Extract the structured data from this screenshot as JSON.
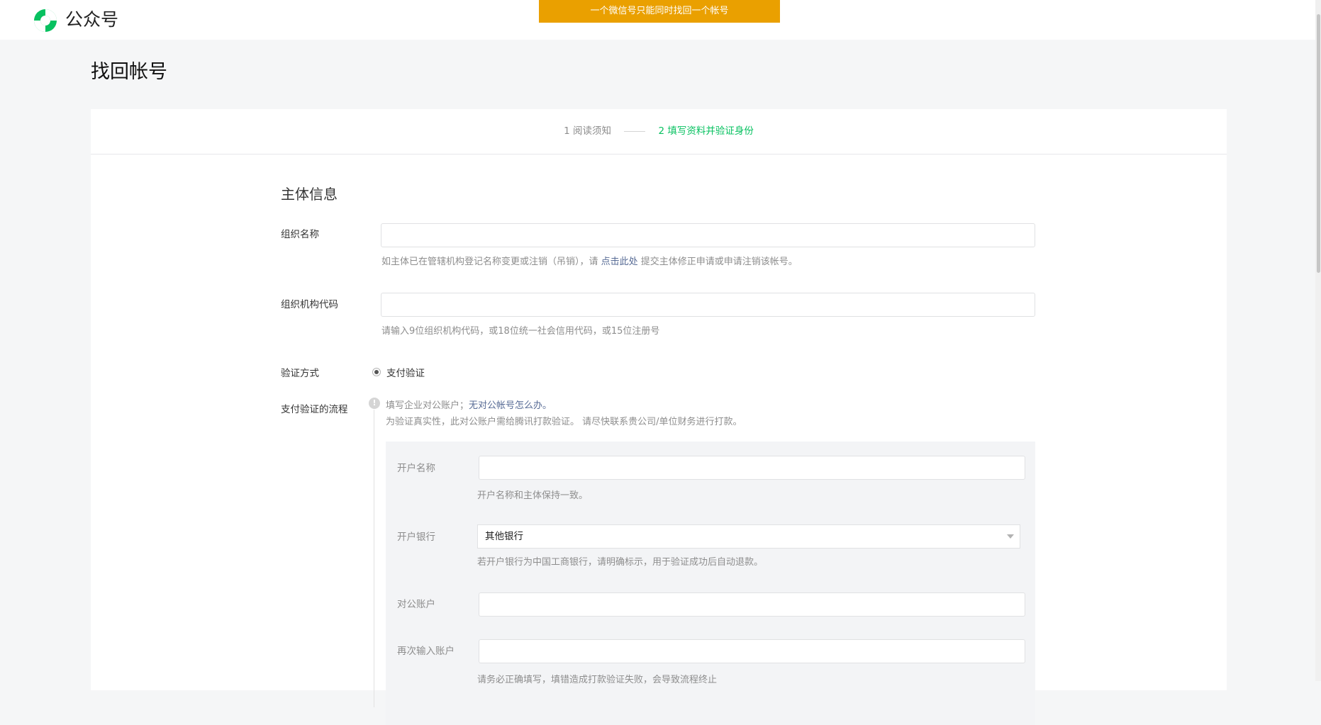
{
  "header": {
    "brand": "公众号",
    "notice": "一个微信号只能同时找回一个帐号"
  },
  "page": {
    "title": "找回帐号"
  },
  "steps": {
    "step1": "1 阅读须知",
    "step2": "2 填写资料并验证身份"
  },
  "section": {
    "title": "主体信息"
  },
  "form": {
    "org_name": {
      "label": "组织名称",
      "tip_before": "如主体已在管辖机构登记名称变更或注销（吊销），请 ",
      "tip_link": "点击此处",
      "tip_after": " 提交主体修正申请或申请注销该帐号。"
    },
    "org_code": {
      "label": "组织机构代码",
      "tip": "请输入9位组织机构代码，或18位统一社会信用代码，或15位注册号"
    },
    "verify_method": {
      "label": "验证方式",
      "option": "支付验证"
    },
    "payment_flow": {
      "label": "支付验证的流程",
      "line1": "填写企业对公账户；",
      "line1_link": "无对公帐号怎么办。",
      "line2": "为验证真实性，此对公账户需给腾讯打款验证。 请尽快联系贵公司/单位财务进行打款。",
      "account_name": {
        "label": "开户名称",
        "tip": "开户名称和主体保持一致。"
      },
      "bank": {
        "label": "开户银行",
        "selected": "其他银行",
        "tip": "若开户银行为中国工商银行，请明确标示，用于验证成功后自动退款。"
      },
      "account": {
        "label": "对公账户"
      },
      "account_confirm": {
        "label": "再次输入账户",
        "tip": "请务必正确填写，填错造成打款验证失败，会导致流程终止"
      }
    }
  },
  "colors": {
    "accent_green": "#07c160",
    "notice_orange": "#eaa000",
    "link_blue": "#576b95"
  }
}
